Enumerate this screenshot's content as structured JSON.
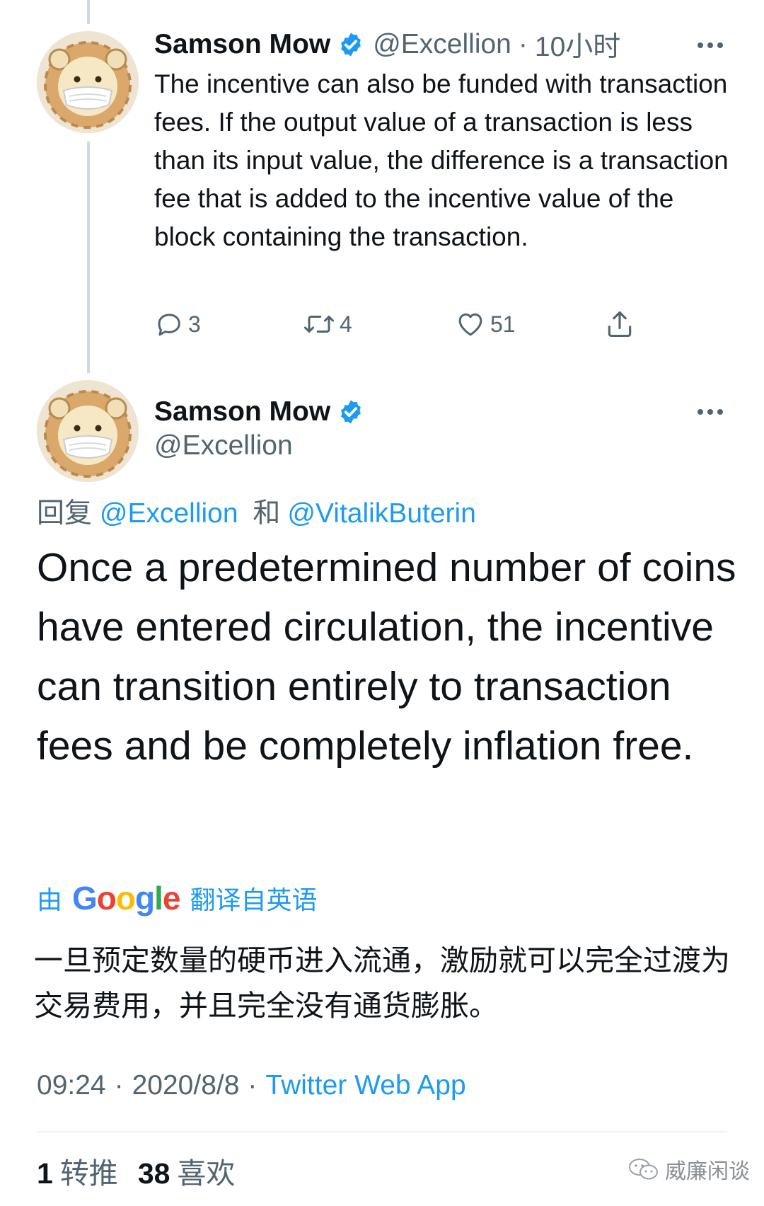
{
  "tweet1": {
    "name": "Samson Mow",
    "handle": "@Excellion",
    "separator": "·",
    "time": "10小时",
    "text": "The incentive can also be funded with transaction fees. If the output value of a transaction is less than its input value, the difference is a transaction fee that is added to the incentive value of the block containing the transaction.",
    "reply_count": "3",
    "retweet_count": "4",
    "like_count": "51"
  },
  "tweet2": {
    "name": "Samson Mow",
    "handle": "@Excellion",
    "reply_prefix": "回复",
    "reply_mention_1": "@Excellion",
    "reply_conjunction": "和",
    "reply_mention_2": "@VitalikButerin",
    "text": "Once a predetermined number of coins have entered circulation, the incentive can transition entirely to transaction fees and be completely inflation free.",
    "translated_prefix": "由",
    "translated_suffix": "翻译自英语",
    "translation": "一旦预定数量的硬币进入流通，激励就可以完全过渡为交易费用，并且完全没有通货膨胀。",
    "time": "09:24",
    "separator": "·",
    "date": "2020/8/8",
    "source": "Twitter Web App",
    "retweets": "1",
    "retweets_label": "转推",
    "likes": "38",
    "likes_label": "喜欢"
  },
  "google_logo": {
    "letters": [
      "G",
      "o",
      "o",
      "g",
      "l",
      "e"
    ],
    "colors": [
      "#4285f4",
      "#ea4335",
      "#fbbc05",
      "#4285f4",
      "#34a853",
      "#ea4335"
    ]
  },
  "watermark": {
    "text": "威廉闲谈",
    "icon": "wechat-icon"
  },
  "colors": {
    "accent": "#1d9bf0",
    "secondary_text": "#536471",
    "primary_text": "#0f1419",
    "thread_line": "#cfd9de"
  }
}
